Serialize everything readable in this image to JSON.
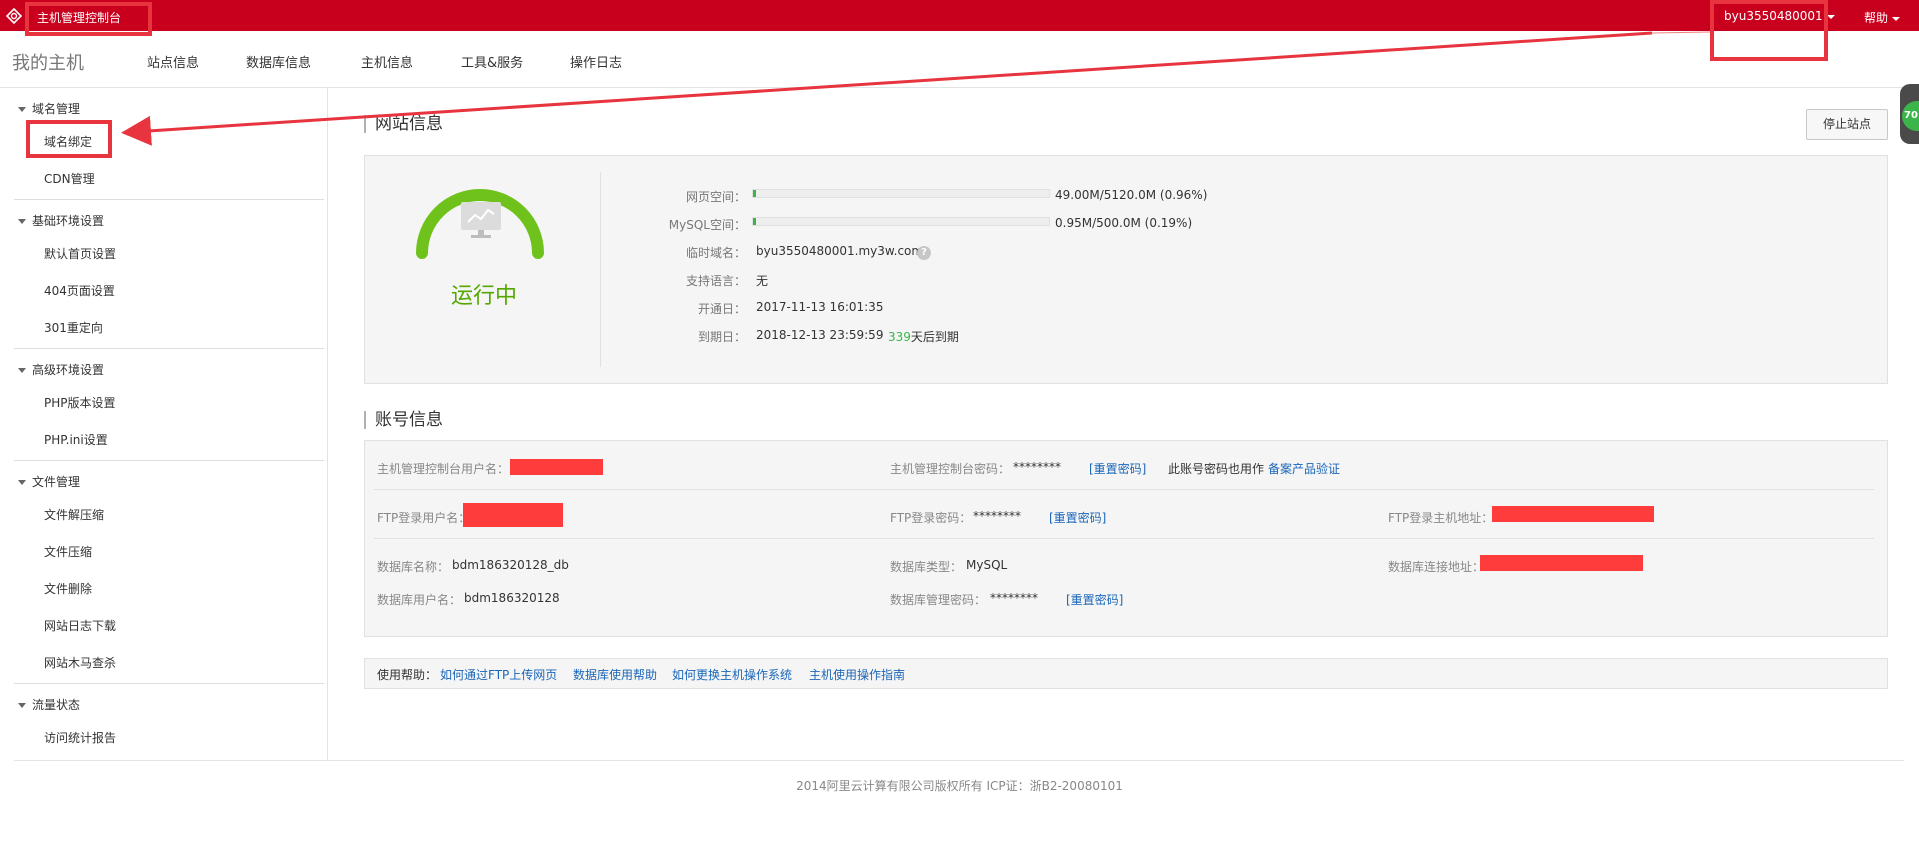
{
  "topbar": {
    "title": "主机管理控制台",
    "user": "byu3550480001",
    "help": "帮助"
  },
  "nav": {
    "brand": "我的主机",
    "items": [
      "站点信息",
      "数据库信息",
      "主机信息",
      "工具&服务",
      "操作日志"
    ]
  },
  "sidebar": {
    "groups": [
      {
        "title": "域名管理",
        "items": [
          "域名绑定",
          "CDN管理"
        ]
      },
      {
        "title": "基础环境设置",
        "items": [
          "默认首页设置",
          "404页面设置",
          "301重定向"
        ]
      },
      {
        "title": "高级环境设置",
        "items": [
          "PHP版本设置",
          "PHP.ini设置"
        ]
      },
      {
        "title": "文件管理",
        "items": [
          "文件解压缩",
          "文件压缩",
          "文件删除",
          "网站日志下载",
          "网站木马查杀"
        ]
      },
      {
        "title": "流量状态",
        "items": [
          "访问统计报告"
        ]
      }
    ]
  },
  "site": {
    "section_title": "网站信息",
    "stop_button": "停止站点",
    "float_badge": "70",
    "status": "运行中",
    "web_space_label": "网页空间：",
    "web_space_value": "49.00M/5120.0M (0.96%)",
    "web_space_fraction": 0.0096,
    "mysql_space_label": "MySQL空间：",
    "mysql_space_value": "0.95M/500.0M (0.19%)",
    "mysql_space_fraction": 0.0019,
    "temp_domain_label": "临时域名：",
    "temp_domain_value": "byu3550480001.my3w.com",
    "temp_domain_help": "?",
    "language_label": "支持语言：",
    "language_value": "无",
    "open_date_label": "开通日：",
    "open_date_value": "2017-11-13 16:01:35",
    "expire_date_label": "到期日：",
    "expire_date_value": "2018-12-13 23:59:59",
    "days_left": "339",
    "days_left_suffix": "天后到期"
  },
  "account": {
    "section_title": "账号信息",
    "console_user_label": "主机管理控制台用户名：",
    "console_pwd_label": "主机管理控制台密码：",
    "console_pwd_value": "********",
    "reset_label": "[重置密码]",
    "also_note": "此账号密码也用作",
    "beian_link": "备案产品验证",
    "ftp_user_label": "FTP登录用户名：",
    "ftp_pwd_label": "FTP登录密码：",
    "ftp_pwd_value": "********",
    "ftp_host_label": "FTP登录主机地址：",
    "db_name_label": "数据库名称：",
    "db_name_value": "bdm186320128_db",
    "db_type_label": "数据库类型：",
    "db_type_value": "MySQL",
    "db_conn_label": "数据库连接地址：",
    "db_user_label": "数据库用户名：",
    "db_user_value": "bdm186320128",
    "db_pwd_label": "数据库管理密码：",
    "db_pwd_value": "********"
  },
  "help_bar": {
    "label": "使用帮助：",
    "links": [
      "如何通过FTP上传网页",
      "数据库使用帮助",
      "如何更换主机操作系统",
      "主机使用操作指南"
    ]
  },
  "footer": {
    "text": "2014阿里云计算有限公司版权所有 ICP证：浙B2-20080101"
  },
  "colors": {
    "brand_red": "#c8001e",
    "status_green": "#55a800",
    "link_blue": "#1a66b9",
    "annotation_red": "#e8343e"
  }
}
